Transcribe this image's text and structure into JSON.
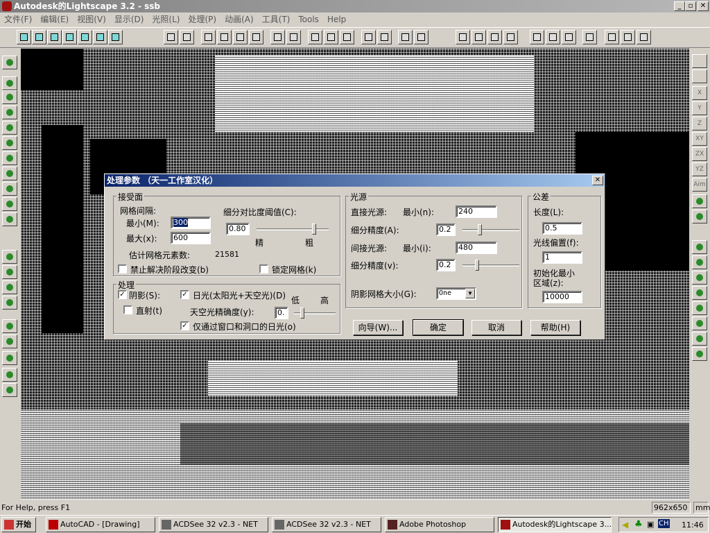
{
  "window": {
    "title": "Autodesk的Lightscape 3.2  - ssb",
    "controls": [
      "_",
      "▫",
      "✕"
    ]
  },
  "menu": [
    "文件(F)",
    "编辑(E)",
    "视图(V)",
    "显示(D)",
    "光照(L)",
    "处理(P)",
    "动画(A)",
    "工具(T)",
    "Tools",
    "Help"
  ],
  "right_toolbar": [
    "X",
    "Y",
    "Z",
    "XY",
    "ZX",
    "YZ",
    "Aim"
  ],
  "dialog": {
    "title": "处理参数 （天一工作室汉化）",
    "close": "✕",
    "receiver": {
      "group": "接受面",
      "mesh_spacing": "网格间隔:",
      "min_label": "最小(M):",
      "min_value": "300",
      "max_label": "最大(x):",
      "max_value": "600",
      "contrast_label": "细分对比度阈值(C):",
      "contrast_value": "0.80",
      "contrast_slider": 0.8,
      "fine": "精",
      "coarse": "粗",
      "est_label": "估计网格元素数:",
      "est_value": "21581",
      "disable_label": "禁止解决阶段改变(b)",
      "disable_checked": false,
      "lock_label": "锁定网格(k)",
      "lock_checked": false
    },
    "processing": {
      "group": "处理",
      "shadows_label": "阴影(S):",
      "shadows_checked": true,
      "direct_label": "直射(t)",
      "direct_checked": false,
      "daylight_label": "日光(太阳光+天空光)(D)",
      "daylight_checked": true,
      "low": "低",
      "high": "高",
      "sky_label": "天空光精确度(y):",
      "sky_value": "0.",
      "sky_slider": 0.2,
      "windows_label": "仅通过窗口和洞口的日光(o)",
      "windows_checked": true
    },
    "light_sources": {
      "group": "光源",
      "direct_label": "直接光源:",
      "direct_min_label": "最小(n):",
      "direct_min": "240",
      "direct_sub_label": "细分精度(A):",
      "direct_sub": "0.2",
      "direct_slider": 0.3,
      "indirect_label": "间接光源:",
      "indirect_min_label": "最小(i):",
      "indirect_min": "480",
      "indirect_sub_label": "细分精度(v):",
      "indirect_sub": "0.2",
      "indirect_slider": 0.25,
      "shadow_grid_label": "阴影网格大小(G):",
      "shadow_grid_value": "One"
    },
    "tolerances": {
      "group": "公差",
      "length_label": "长度(L):",
      "length_value": "0.5",
      "offset_label": "光线偏置(f):",
      "offset_value": "1",
      "init_label1": "初始化最小",
      "init_label2": "区域(z):",
      "init_value": "10000"
    },
    "buttons": {
      "wizard": "向导(W)...",
      "ok": "确定",
      "cancel": "取消",
      "help": "帮助(H)"
    }
  },
  "status": {
    "text": "For Help, press F1",
    "size": "962x650",
    "unit": "mm"
  },
  "taskbar": {
    "start": "开始",
    "tasks": [
      "AutoCAD - [Drawing]",
      "ACDSee 32 v2.3 - NET",
      "ACDSee 32 v2.3 - NET",
      "Adobe Photoshop",
      "Autodesk的Lightscape 3...."
    ],
    "ime": "CH",
    "clock": "11:46"
  }
}
